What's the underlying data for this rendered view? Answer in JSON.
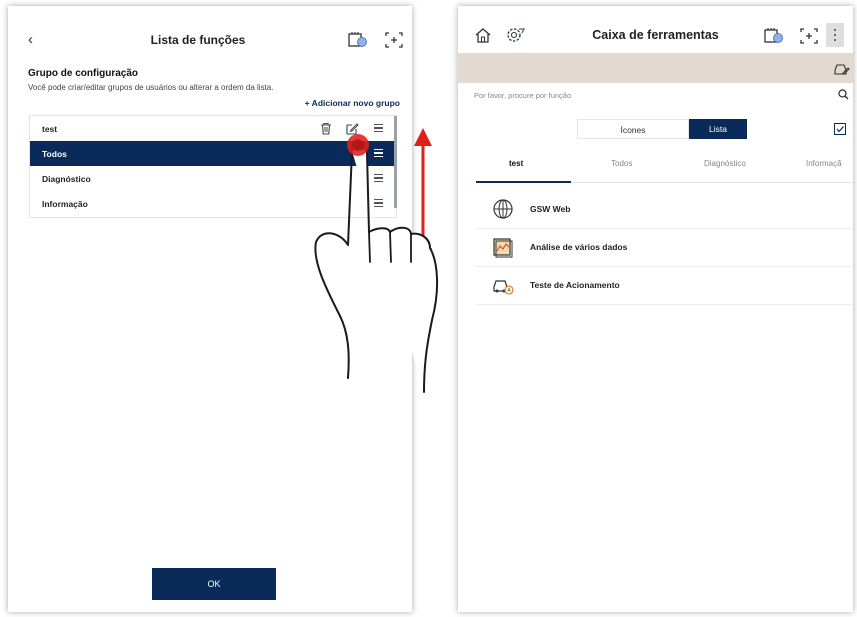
{
  "left": {
    "header": {
      "back_glyph": "‹",
      "title": "Lista de funções"
    },
    "group_title": "Grupo de configuração",
    "group_desc": "Você pode criar/editar grupos de usuários ou alterar a ordem da lista.",
    "add_group": "+ Adicionar novo grupo",
    "groups": [
      {
        "label": "test"
      },
      {
        "label": "Todos"
      },
      {
        "label": "Diagnóstico"
      },
      {
        "label": "Informação"
      }
    ],
    "ok_label": "OK"
  },
  "right": {
    "header": {
      "title": "Caixa de ferramentas"
    },
    "search": {
      "placeholder": "Por favor, procure por função"
    },
    "view_toggle": {
      "icons": "Ícones",
      "list": "Lista"
    },
    "tabs": [
      "test",
      "Todos",
      "Diagnóstico",
      "Informaçã"
    ],
    "tools": [
      {
        "name": "GSW Web",
        "icon": "globe-icon"
      },
      {
        "name": "Análise de vários dados",
        "icon": "data-chart-icon"
      },
      {
        "name": "Teste de Acionamento",
        "icon": "car-test-icon"
      }
    ]
  },
  "colors": {
    "accent": "#0a2b5a",
    "banner": "#e2dad0",
    "arrow": "#e0201b"
  }
}
